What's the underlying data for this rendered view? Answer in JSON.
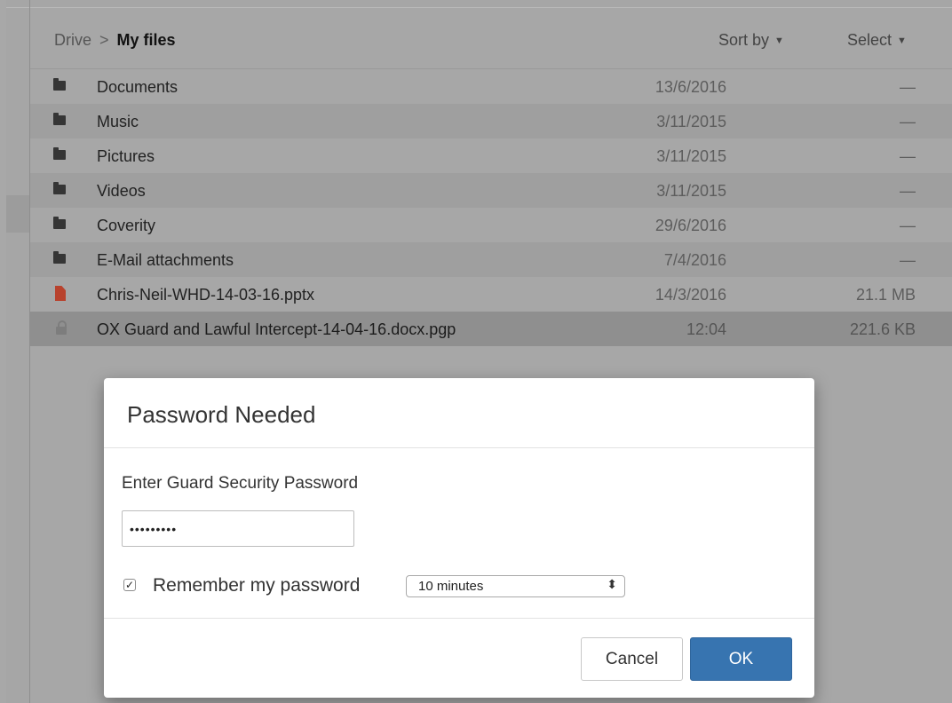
{
  "breadcrumb": {
    "root": "Drive",
    "separator": ">",
    "current": "My files"
  },
  "toolbar": {
    "sort_label": "Sort by",
    "select_label": "Select",
    "caret_icon": "caret-down-icon"
  },
  "files": [
    {
      "name": "Documents",
      "date": "13/6/2016",
      "size": "—",
      "icon": "folder-icon"
    },
    {
      "name": "Music",
      "date": "3/11/2015",
      "size": "—",
      "icon": "folder-icon"
    },
    {
      "name": "Pictures",
      "date": "3/11/2015",
      "size": "—",
      "icon": "folder-icon"
    },
    {
      "name": "Videos",
      "date": "3/11/2015",
      "size": "—",
      "icon": "folder-icon"
    },
    {
      "name": "Coverity",
      "date": "29/6/2016",
      "size": "—",
      "icon": "folder-icon"
    },
    {
      "name": "E-Mail attachments",
      "date": "7/4/2016",
      "size": "—",
      "icon": "folder-icon"
    },
    {
      "name": "Chris-Neil-WHD-14-03-16.pptx",
      "date": "14/3/2016",
      "size": "21.1 MB",
      "icon": "pptx-file-icon"
    },
    {
      "name": "OX Guard and Lawful Intercept-14-04-16.docx.pgp",
      "date": "12:04",
      "size": "221.6 KB",
      "icon": "lock-icon",
      "selected": true
    }
  ],
  "dialog": {
    "title": "Password Needed",
    "label": "Enter Guard Security Password",
    "password_value": "•••••••••",
    "remember_label": "Remember my password",
    "remember_checked": true,
    "duration_value": "10 minutes",
    "cancel_label": "Cancel",
    "ok_label": "OK"
  },
  "colors": {
    "primary_button": "#3774b0",
    "pptx_icon": "#b8422d",
    "overlay": "#a7a7a7"
  }
}
